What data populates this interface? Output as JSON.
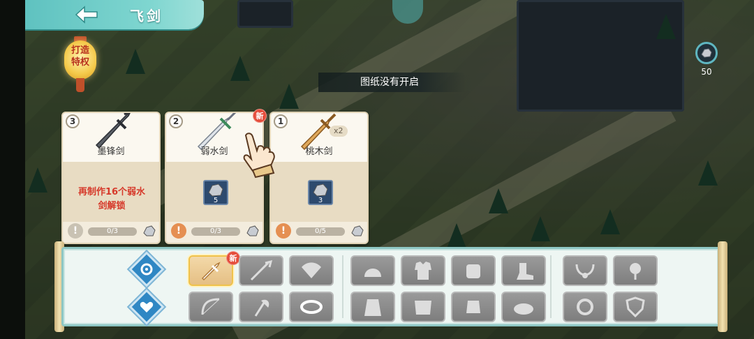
{
  "header": {
    "title": "飞剑"
  },
  "lantern": {
    "label_line1": "打造",
    "label_line2": "特权"
  },
  "currency": {
    "amount": "50",
    "icon": "ore-icon"
  },
  "toast": {
    "text": "图纸没有开启"
  },
  "cards": [
    {
      "rank": "3",
      "name": "墨锋剑",
      "unlock_text_line1": "再制作16个弱水",
      "unlock_text_line2": "剑解锁",
      "progress": "0/3",
      "new": false
    },
    {
      "rank": "2",
      "name": "弱水剑",
      "material_qty": "5",
      "progress": "0/3",
      "new": true,
      "new_label": "新"
    },
    {
      "rank": "1",
      "name": "桃木剑",
      "material_qty": "3",
      "progress": "0/5",
      "new": false,
      "multiplier": "x2"
    }
  ],
  "categories": {
    "sword_new_label": "新",
    "slots_row1": [
      "sword-slot",
      "spear-slot",
      "fan-slot",
      "helmet-slot",
      "armor-slot",
      "bracer-slot",
      "boots-slot",
      "necklace-slot",
      "jade-pendant-slot"
    ],
    "slots_row2": [
      "bow-slot",
      "axe-slot",
      "belt-slot",
      "robe-slot",
      "chestplate-slot",
      "gauntlet-slot",
      "shoe-slot",
      "ring-slot",
      "shield-slot"
    ]
  },
  "colors": {
    "accent_teal": "#5fc2c0",
    "new_red": "#e54d3b",
    "unlock_red": "#d6392a"
  }
}
